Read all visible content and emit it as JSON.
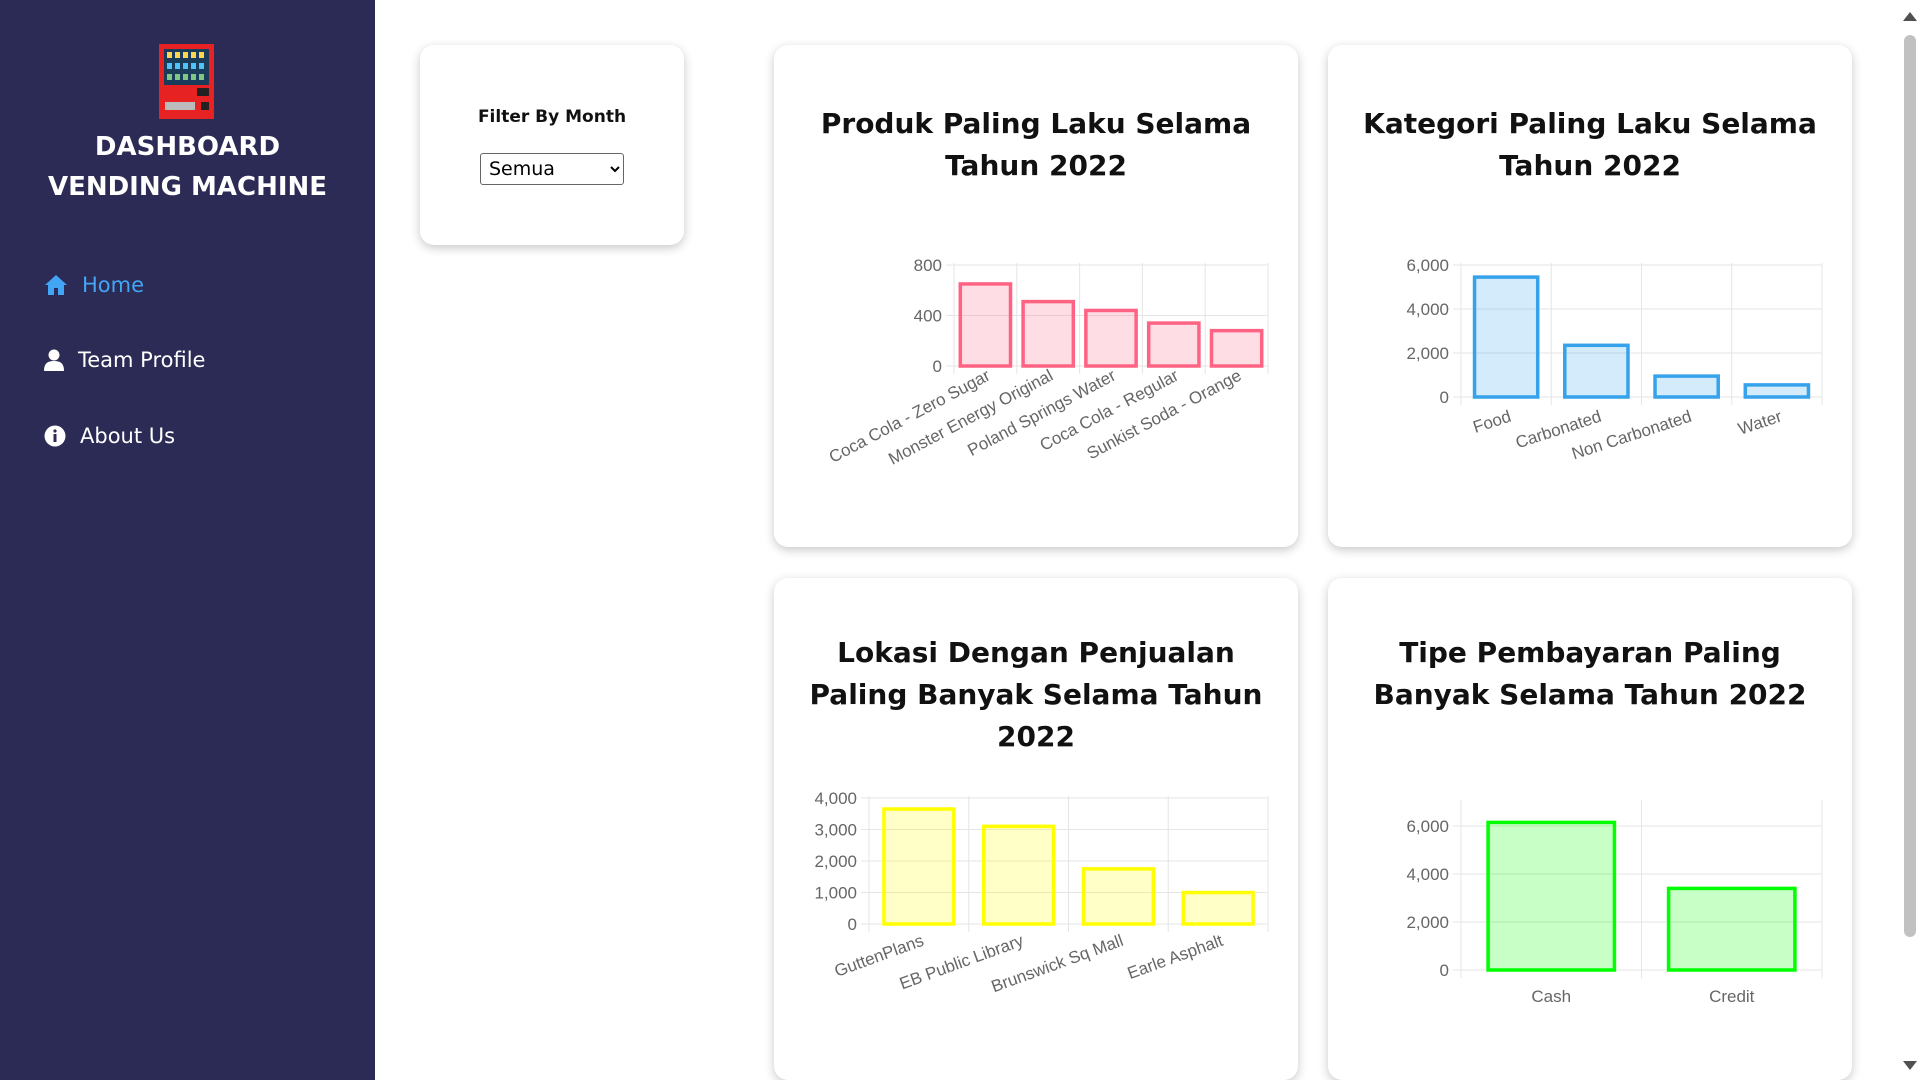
{
  "sidebar": {
    "brand_title": "DASHBOARD VENDING MACHINE",
    "items": [
      {
        "label": "Home",
        "icon": "home-icon",
        "active": true
      },
      {
        "label": "Team Profile",
        "icon": "user-icon",
        "active": false
      },
      {
        "label": "About Us",
        "icon": "info-icon",
        "active": false
      }
    ]
  },
  "filter": {
    "title": "Filter By Month",
    "selected": "Semua"
  },
  "colors": {
    "sidebar_bg": "#2c2b55",
    "active_nav": "#42a5f5",
    "pink": "#ff6384",
    "blue": "#36a2eb",
    "yellow": "#ffff00",
    "green": "#00ff00"
  },
  "cards": [
    {
      "title": "Produk Paling Laku Selama Tahun 2022"
    },
    {
      "title": "Kategori Paling Laku Selama Tahun 2022"
    },
    {
      "title": "Lokasi Dengan Penjualan Paling Banyak Selama Tahun 2022"
    },
    {
      "title": "Tipe Pembayaran Paling Banyak Selama Tahun 2022"
    }
  ],
  "chart_data": [
    {
      "type": "bar",
      "title": "Produk Paling Laku Selama Tahun 2022",
      "categories": [
        "Coca Cola - Zero Sugar",
        "Monster Energy Original",
        "Poland Springs Water",
        "Coca Cola - Regular",
        "Sunkist Soda - Orange"
      ],
      "values": [
        650,
        510,
        440,
        340,
        280
      ],
      "ylim": [
        0,
        800
      ],
      "yticks": [
        0,
        400,
        800
      ],
      "ytick_labels": [
        "0",
        "400",
        "800"
      ],
      "color": "#ff6384",
      "grid": true,
      "legend": "none"
    },
    {
      "type": "bar",
      "title": "Kategori Paling Laku Selama Tahun 2022",
      "categories": [
        "Food",
        "Carbonated",
        "Non Carbonated",
        "Water"
      ],
      "values": [
        5450,
        2350,
        950,
        550
      ],
      "ylim": [
        0,
        6000
      ],
      "yticks": [
        0,
        2000,
        4000,
        6000
      ],
      "ytick_labels": [
        "0",
        "2,000",
        "4,000",
        "6,000"
      ],
      "color": "#36a2eb",
      "grid": true,
      "legend": "none"
    },
    {
      "type": "bar",
      "title": "Lokasi Dengan Penjualan Paling Banyak Selama Tahun 2022",
      "categories": [
        "GuttenPlans",
        "EB Public Library",
        "Brunswick Sq Mall",
        "Earle Asphalt"
      ],
      "values": [
        3650,
        3100,
        1750,
        1000
      ],
      "ylim": [
        0,
        4000
      ],
      "yticks": [
        0,
        1000,
        2000,
        3000,
        4000
      ],
      "ytick_labels": [
        "0",
        "1,000",
        "2,000",
        "3,000",
        "4,000"
      ],
      "color": "#ffff00",
      "grid": true,
      "legend": "none"
    },
    {
      "type": "bar",
      "title": "Tipe Pembayaran Paling Banyak Selama Tahun 2022",
      "categories": [
        "Cash",
        "Credit"
      ],
      "values": [
        6150,
        3400
      ],
      "ylim": [
        0,
        7000
      ],
      "yticks": [
        0,
        2000,
        4000,
        6000
      ],
      "ytick_labels": [
        "0",
        "2,000",
        "4,000",
        "6,000"
      ],
      "color": "#00ff00",
      "grid": true,
      "legend": "none"
    }
  ]
}
